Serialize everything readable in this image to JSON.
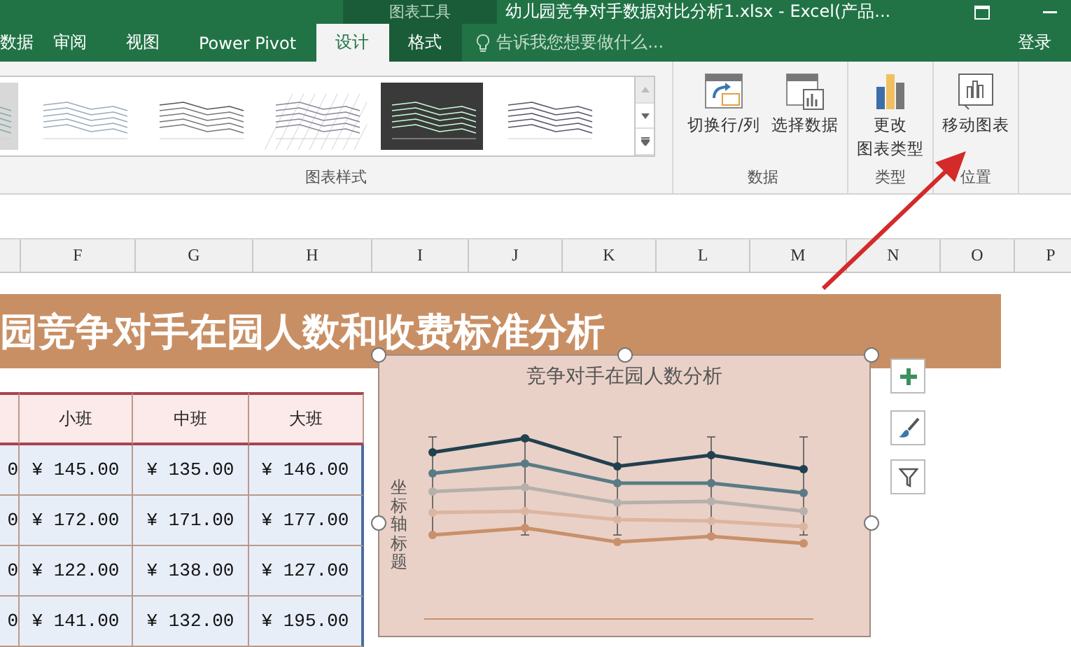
{
  "title_bar": {
    "context_label": "图表工具",
    "title": "幼儿园竞争对手数据对比分析1.xlsx - Excel(产品..."
  },
  "tabs": [
    {
      "label": "数据",
      "selected": false,
      "contextual": false
    },
    {
      "label": "审阅",
      "selected": false,
      "contextual": false
    },
    {
      "label": "视图",
      "selected": false,
      "contextual": false
    },
    {
      "label": "Power Pivot",
      "selected": false,
      "contextual": false
    },
    {
      "label": "设计",
      "selected": true,
      "contextual": true
    },
    {
      "label": "格式",
      "selected": false,
      "contextual": true
    }
  ],
  "search": {
    "placeholder": "告诉我您想要做什么..."
  },
  "sign_in": "登录",
  "gallery": {
    "label": "图表样式",
    "styles": [
      {
        "kind": "gray"
      },
      {
        "kind": "white"
      },
      {
        "kind": "yellow"
      },
      {
        "kind": "hatched"
      },
      {
        "kind": "dark"
      },
      {
        "kind": "labels"
      }
    ]
  },
  "groups": [
    {
      "label": "数据",
      "buttons": [
        {
          "kind": "switch",
          "lines": [
            "切换行/列"
          ]
        },
        {
          "kind": "select",
          "lines": [
            "选择数据"
          ]
        }
      ]
    },
    {
      "label": "类型",
      "buttons": [
        {
          "kind": "change",
          "lines": [
            "更改",
            "图表类型"
          ]
        }
      ]
    },
    {
      "label": "位置",
      "buttons": [
        {
          "kind": "move",
          "lines": [
            "移动图表"
          ]
        }
      ]
    }
  ],
  "columns": [
    "F",
    "G",
    "H",
    "I",
    "J",
    "K",
    "L",
    "M",
    "N",
    "O",
    "P"
  ],
  "banner": "园竞争对手在园人数和收费标准分析",
  "table": {
    "headers": [
      "小班",
      "中班",
      "大班"
    ],
    "rows": [
      [
        "0",
        "¥ 145.00",
        "¥ 135.00",
        "¥ 146.00"
      ],
      [
        "0",
        "¥ 172.00",
        "¥ 171.00",
        "¥ 177.00"
      ],
      [
        "0",
        "¥ 122.00",
        "¥ 138.00",
        "¥ 127.00"
      ],
      [
        "0",
        "¥ 141.00",
        "¥ 132.00",
        "¥ 195.00"
      ]
    ]
  },
  "chart": {
    "title": "竞争对手在园人数分析",
    "axis_title": "坐标轴标题"
  }
}
